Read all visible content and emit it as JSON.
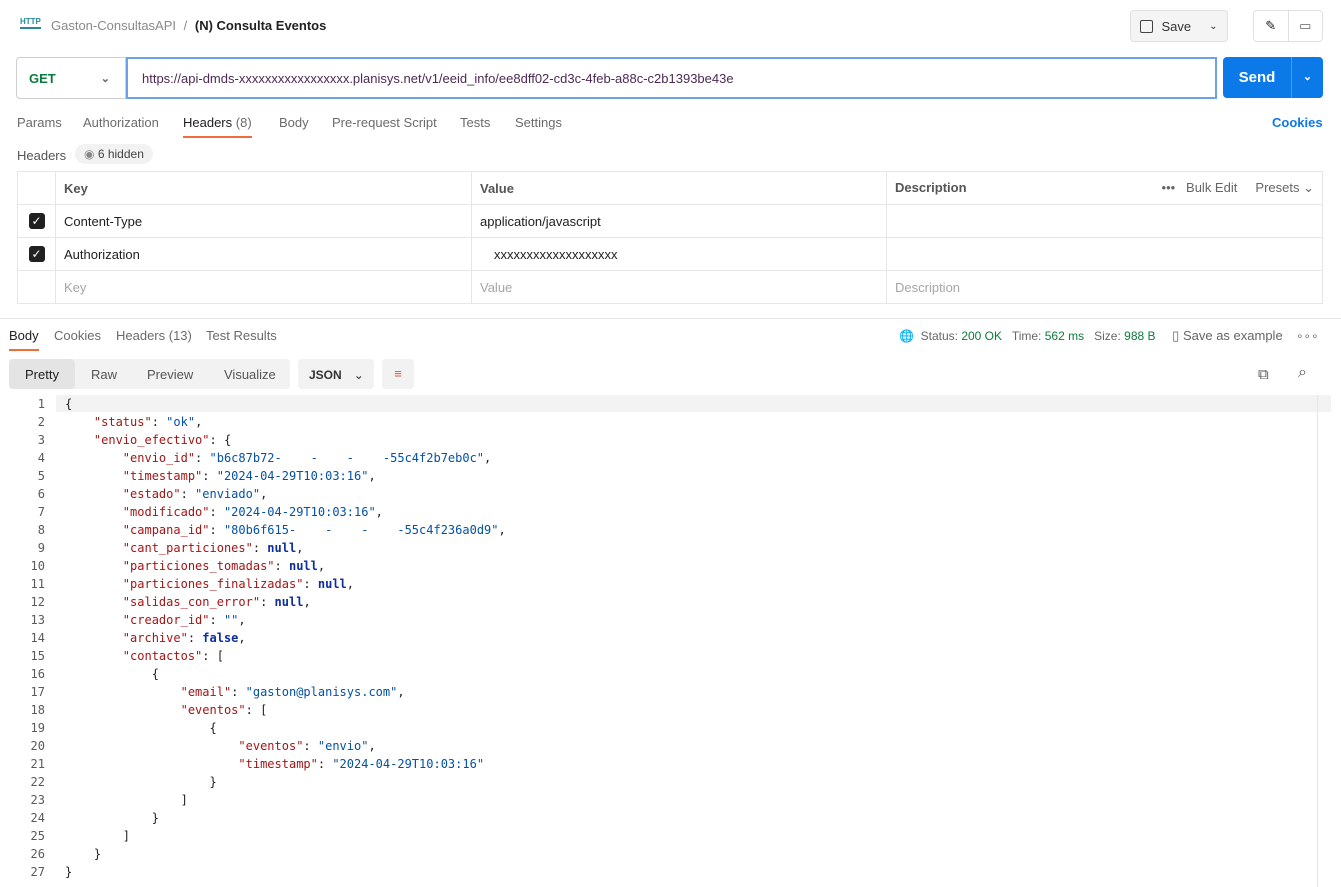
{
  "header": {
    "breadcrumb_parent": "Gaston-ConsultasAPI",
    "separator": "/",
    "title": "(N) Consulta Eventos",
    "save_label": "Save",
    "http_icon": "HTTP"
  },
  "request": {
    "method": "GET",
    "url": "https://api-dmds-xxxxxxxxxxxxxxxxx.planisys.net/v1/eeid_info/ee8dff02-cd3c-4feb-a88c-c2b1393be43e",
    "send_label": "Send"
  },
  "request_tabs": [
    "Params",
    "Authorization",
    "Headers",
    "(8)",
    "Body",
    "Pre-request Script",
    "Tests",
    "Settings"
  ],
  "cookies_label": "Cookies",
  "headers_section": {
    "label": "Headers",
    "hidden": "6 hidden",
    "columns": [
      "Key",
      "Value",
      "Description"
    ],
    "bulk_edit": "Bulk Edit",
    "presets": "Presets",
    "rows": [
      {
        "key": "Content-Type",
        "value": "application/javascript",
        "checked": true
      },
      {
        "key": "Authorization",
        "value": "xxxxxxxxxxxxxxxxxxx",
        "checked": true
      }
    ],
    "placeholder": {
      "key": "Key",
      "value": "Value",
      "description": "Description"
    }
  },
  "response_tabs": [
    "Body",
    "Cookies",
    "Headers (13)",
    "Test Results"
  ],
  "status": {
    "status_label": "Status:",
    "status": "200 OK",
    "time_label": "Time:",
    "time": "562 ms",
    "size_label": "Size:",
    "size": "988 B",
    "save_example": "Save as example"
  },
  "view_modes": [
    "Pretty",
    "Raw",
    "Preview",
    "Visualize"
  ],
  "format": "JSON",
  "code_lines": [
    [
      [
        "{",
        "p"
      ]
    ],
    [
      [
        "    ",
        ""
      ],
      [
        "\"status\"",
        "k"
      ],
      [
        ": ",
        "p"
      ],
      [
        "\"ok\"",
        "s"
      ],
      [
        ",",
        "p"
      ]
    ],
    [
      [
        "    ",
        ""
      ],
      [
        "\"envio_efectivo\"",
        "k"
      ],
      [
        ": {",
        "p"
      ]
    ],
    [
      [
        "        ",
        ""
      ],
      [
        "\"envio_id\"",
        "k"
      ],
      [
        ": ",
        "p"
      ],
      [
        "\"b6c87b72-    -    -    -55c4f2b7eb0c\"",
        "s"
      ],
      [
        ",",
        "p"
      ]
    ],
    [
      [
        "        ",
        ""
      ],
      [
        "\"timestamp\"",
        "k"
      ],
      [
        ": ",
        "p"
      ],
      [
        "\"2024-04-29T10:03:16\"",
        "s"
      ],
      [
        ",",
        "p"
      ]
    ],
    [
      [
        "        ",
        ""
      ],
      [
        "\"estado\"",
        "k"
      ],
      [
        ": ",
        "p"
      ],
      [
        "\"enviado\"",
        "s"
      ],
      [
        ",",
        "p"
      ]
    ],
    [
      [
        "        ",
        ""
      ],
      [
        "\"modificado\"",
        "k"
      ],
      [
        ": ",
        "p"
      ],
      [
        "\"2024-04-29T10:03:16\"",
        "s"
      ],
      [
        ",",
        "p"
      ]
    ],
    [
      [
        "        ",
        ""
      ],
      [
        "\"campana_id\"",
        "k"
      ],
      [
        ": ",
        "p"
      ],
      [
        "\"80b6f615-    -    -    -55c4f236a0d9\"",
        "s"
      ],
      [
        ",",
        "p"
      ]
    ],
    [
      [
        "        ",
        ""
      ],
      [
        "\"cant_particiones\"",
        "k"
      ],
      [
        ": ",
        "p"
      ],
      [
        "null",
        "n"
      ],
      [
        ",",
        "p"
      ]
    ],
    [
      [
        "        ",
        ""
      ],
      [
        "\"particiones_tomadas\"",
        "k"
      ],
      [
        ": ",
        "p"
      ],
      [
        "null",
        "n"
      ],
      [
        ",",
        "p"
      ]
    ],
    [
      [
        "        ",
        ""
      ],
      [
        "\"particiones_finalizadas\"",
        "k"
      ],
      [
        ": ",
        "p"
      ],
      [
        "null",
        "n"
      ],
      [
        ",",
        "p"
      ]
    ],
    [
      [
        "        ",
        ""
      ],
      [
        "\"salidas_con_error\"",
        "k"
      ],
      [
        ": ",
        "p"
      ],
      [
        "null",
        "n"
      ],
      [
        ",",
        "p"
      ]
    ],
    [
      [
        "        ",
        ""
      ],
      [
        "\"creador_id\"",
        "k"
      ],
      [
        ": ",
        "p"
      ],
      [
        "\"\"",
        "s"
      ],
      [
        ",",
        "p"
      ]
    ],
    [
      [
        "        ",
        ""
      ],
      [
        "\"archive\"",
        "k"
      ],
      [
        ": ",
        "p"
      ],
      [
        "false",
        "n"
      ],
      [
        ",",
        "p"
      ]
    ],
    [
      [
        "        ",
        ""
      ],
      [
        "\"contactos\"",
        "k"
      ],
      [
        ": [",
        "p"
      ]
    ],
    [
      [
        "            {",
        ""
      ]
    ],
    [
      [
        "                ",
        ""
      ],
      [
        "\"email\"",
        "k"
      ],
      [
        ": ",
        "p"
      ],
      [
        "\"gaston@planisys.com\"",
        "s"
      ],
      [
        ",",
        "p"
      ]
    ],
    [
      [
        "                ",
        ""
      ],
      [
        "\"eventos\"",
        "k"
      ],
      [
        ": [",
        "p"
      ]
    ],
    [
      [
        "                    {",
        ""
      ]
    ],
    [
      [
        "                        ",
        ""
      ],
      [
        "\"eventos\"",
        "k"
      ],
      [
        ": ",
        "p"
      ],
      [
        "\"envio\"",
        "s"
      ],
      [
        ",",
        "p"
      ]
    ],
    [
      [
        "                        ",
        ""
      ],
      [
        "\"timestamp\"",
        "k"
      ],
      [
        ": ",
        "p"
      ],
      [
        "\"2024-04-29T10:03:16\"",
        "s"
      ]
    ],
    [
      [
        "                    }",
        ""
      ]
    ],
    [
      [
        "                ]",
        ""
      ]
    ],
    [
      [
        "            }",
        ""
      ]
    ],
    [
      [
        "        ]",
        ""
      ]
    ],
    [
      [
        "    }",
        ""
      ]
    ],
    [
      [
        "}",
        "p"
      ]
    ]
  ]
}
